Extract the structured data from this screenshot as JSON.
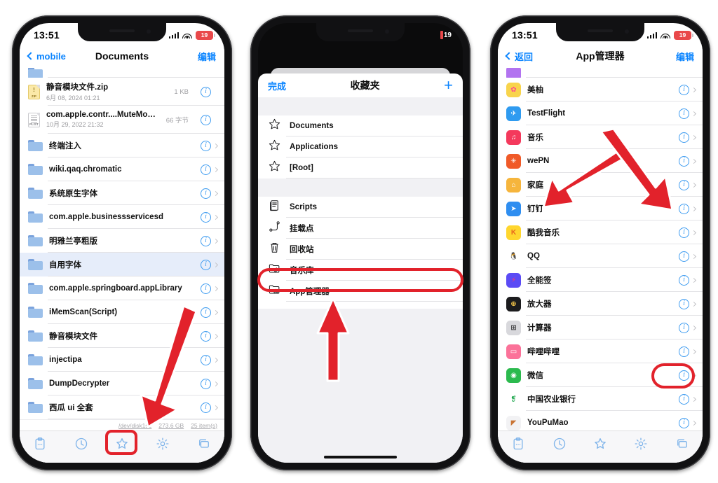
{
  "accent": {
    "ios_blue": "#0a84ff",
    "info_blue": "#3d9bf0",
    "annotation_red": "#e2222b",
    "selected_row": "#e6edfa"
  },
  "phone1": {
    "status": {
      "time": "13:51",
      "battery_level": "19",
      "signal_icon": "cellular-bars-icon",
      "wifi_icon": "wifi-icon",
      "battery_icon": "battery-low-icon"
    },
    "nav": {
      "back_label": "mobile",
      "title": "Documents",
      "edit_label": "编辑"
    },
    "rows": [
      {
        "name": "静音模块文件.zip",
        "date": "6月 08, 2024 01:21",
        "size": "1 KB",
        "icon": "zip-file-icon",
        "kind": "file",
        "chevron": false,
        "selected": false
      },
      {
        "name": "com.apple.contr....MuteModule.plist",
        "date": "10月 29, 2022 21:32",
        "size": "66 字节",
        "icon": "plist-file-icon",
        "kind": "file",
        "chevron": false,
        "selected": false
      },
      {
        "name": "终端注入",
        "icon": "folder-icon",
        "kind": "folder",
        "chevron": true,
        "selected": false
      },
      {
        "name": "wiki.qaq.chromatic",
        "icon": "folder-icon",
        "kind": "folder",
        "chevron": true,
        "selected": false
      },
      {
        "name": "系统原生字体",
        "icon": "folder-icon",
        "kind": "folder",
        "chevron": true,
        "selected": false
      },
      {
        "name": "com.apple.businessservicesd",
        "icon": "folder-icon",
        "kind": "folder",
        "chevron": true,
        "selected": false
      },
      {
        "name": "明雅兰亭粗版",
        "icon": "folder-icon",
        "kind": "folder",
        "chevron": true,
        "selected": false
      },
      {
        "name": "自用字体",
        "icon": "folder-icon",
        "kind": "folder",
        "chevron": true,
        "selected": true
      },
      {
        "name": "com.apple.springboard.appLibrary",
        "icon": "folder-icon",
        "kind": "folder",
        "chevron": true,
        "selected": false
      },
      {
        "name": "iMemScan(Script)",
        "icon": "folder-icon",
        "kind": "folder",
        "chevron": true,
        "selected": false
      },
      {
        "name": "静音模块文件",
        "icon": "folder-icon",
        "kind": "folder",
        "chevron": true,
        "selected": false
      },
      {
        "name": "injectipa",
        "icon": "folder-icon",
        "kind": "folder",
        "chevron": true,
        "selected": false
      },
      {
        "name": "DumpDecrypter",
        "icon": "folder-icon",
        "kind": "folder",
        "chevron": true,
        "selected": false
      },
      {
        "name": "西瓜 ui 全套",
        "icon": "folder-icon",
        "kind": "folder",
        "chevron": true,
        "selected": false
      }
    ],
    "footer": {
      "path": "/dev/disk1s2",
      "capacity": "273.6 GB",
      "count": "25 item(s)"
    },
    "tabs": [
      {
        "icon": "clipboard-icon",
        "active": false
      },
      {
        "icon": "clock-icon",
        "active": false
      },
      {
        "icon": "star-icon",
        "active": true
      },
      {
        "icon": "gear-icon",
        "active": false
      },
      {
        "icon": "windows-icon",
        "active": false
      }
    ]
  },
  "phone2": {
    "status": {
      "battery_level": "19",
      "battery_icon": "battery-low-icon"
    },
    "sheet_nav": {
      "done_label": "完成",
      "title": "收藏夹",
      "add_label": "+"
    },
    "favorites_group1": [
      {
        "label": "Documents",
        "icon": "star-outline-icon"
      },
      {
        "label": "Applications",
        "icon": "star-outline-icon"
      },
      {
        "label": "[Root]",
        "icon": "star-outline-icon"
      }
    ],
    "favorites_group2": [
      {
        "label": "Scripts",
        "icon": "scripts-icon",
        "highlighted": false
      },
      {
        "label": "挂载点",
        "icon": "mount-point-icon",
        "highlighted": false
      },
      {
        "label": "回收站",
        "icon": "trash-icon",
        "highlighted": false
      },
      {
        "label": "音乐库",
        "icon": "music-library-icon",
        "highlighted": false
      },
      {
        "label": "App管理器",
        "icon": "app-manager-icon",
        "highlighted": true
      }
    ]
  },
  "phone3": {
    "status": {
      "time": "13:51",
      "battery_level": "19",
      "signal_icon": "cellular-bars-icon",
      "wifi_icon": "wifi-icon",
      "battery_icon": "battery-low-icon"
    },
    "nav": {
      "back_label": "返回",
      "title": "App管理器",
      "edit_label": "编辑"
    },
    "apps": [
      {
        "name": "美柚",
        "icon_color": "#f8d44c",
        "glyph": "✿",
        "glyph_color": "#ff4f8b",
        "highlighted": false
      },
      {
        "name": "TestFlight",
        "icon_color": "#2f9bf0",
        "glyph": "✈",
        "glyph_color": "#ffffff",
        "highlighted": false
      },
      {
        "name": "音乐",
        "icon_color": "#f4395c",
        "glyph": "♫",
        "glyph_color": "#ffffff",
        "highlighted": false
      },
      {
        "name": "wePN",
        "icon_color": "#f05a28",
        "glyph": "✳",
        "glyph_color": "#ffffff",
        "highlighted": false
      },
      {
        "name": "家庭",
        "icon_color": "#f6b53c",
        "glyph": "⌂",
        "glyph_color": "#ffffff",
        "highlighted": false
      },
      {
        "name": "钉钉",
        "icon_color": "#2f8ef0",
        "glyph": "➤",
        "glyph_color": "#ffffff",
        "highlighted": false
      },
      {
        "name": "酷我音乐",
        "icon_color": "#ffd62e",
        "glyph": "K",
        "glyph_color": "#e8651d",
        "highlighted": false
      },
      {
        "name": "QQ",
        "icon_color": "#ffffff",
        "glyph": "🐧",
        "glyph_color": "#1a1a1a",
        "highlighted": false
      },
      {
        "name": "全能签",
        "icon_color": "#5b4bf5",
        "glyph": "⚡",
        "glyph_color": "#ff3b6b",
        "highlighted": false
      },
      {
        "name": "放大器",
        "icon_color": "#1c1c1e",
        "glyph": "⊕",
        "glyph_color": "#f7c84a",
        "highlighted": false
      },
      {
        "name": "计算器",
        "icon_color": "#d8d8dc",
        "glyph": "⊞",
        "glyph_color": "#3a3a3c",
        "highlighted": false
      },
      {
        "name": "哔哩哔哩",
        "icon_color": "#fb7299",
        "glyph": "▭",
        "glyph_color": "#ffffff",
        "highlighted": false
      },
      {
        "name": "微信",
        "icon_color": "#2cba4e",
        "glyph": "◉",
        "glyph_color": "#ffffff",
        "highlighted": true
      },
      {
        "name": "中国农业银行",
        "icon_color": "#ffffff",
        "glyph": "❡",
        "glyph_color": "#1aa54a",
        "highlighted": false
      },
      {
        "name": "YouPuMao",
        "icon_color": "#f2f2f4",
        "glyph": "◤",
        "glyph_color": "#c97434",
        "highlighted": false
      }
    ],
    "tabs": [
      {
        "icon": "clipboard-icon",
        "active": false
      },
      {
        "icon": "clock-icon",
        "active": false
      },
      {
        "icon": "star-icon",
        "active": false
      },
      {
        "icon": "gear-icon",
        "active": false
      },
      {
        "icon": "windows-icon",
        "active": false
      }
    ]
  },
  "annotations": {
    "phone1_star_tab_highlight": "star-tab-highlight",
    "phone1_arrow": "arrow-pointing-to-star-tab",
    "phone2_appmanager_highlight": "app-manager-row-highlight",
    "phone2_arrow": "arrow-pointing-to-app-manager",
    "phone3_wechat_arrow": "arrow-pointing-to-wechat",
    "phone3_info_arrow": "arrow-pointing-to-info-button",
    "phone3_info_highlight": "wechat-info-button-highlight"
  }
}
